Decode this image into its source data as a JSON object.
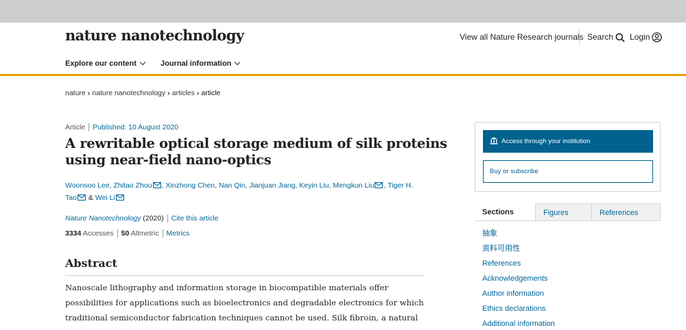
{
  "header": {
    "logo": "nature nanotechnology",
    "view_all": "View all Nature Research journals",
    "search": "Search",
    "login": "Login"
  },
  "nav": {
    "explore": "Explore our content",
    "journal_info": "Journal information"
  },
  "breadcrumb": [
    "nature",
    "nature nanotechnology",
    "articles",
    "article"
  ],
  "article": {
    "type": "Article",
    "published": "Published: 10 August 2020",
    "title": "A rewritable optical storage medium of silk proteins using near-field nano-optics",
    "authors": {
      "a1": "Woonsoo Lee,",
      "a2": "Zhitao Zhou",
      "a3": ", Xinzhong Chen, Nan Qin, Jianjuan Jiang, Keyin Liu, Mengkun Liu",
      "a4": ", Tiger H. Tao",
      "amp": "&",
      "a5": "Wei Li"
    },
    "journal_name": "Nature Nanotechnology",
    "year": "(2020)",
    "cite": "Cite this article",
    "accesses_count": "3334",
    "accesses_label": "Accesses",
    "altmetric_count": "50",
    "altmetric_label": "Altmetric",
    "metrics_link": "Metrics"
  },
  "abstract": {
    "heading": "Abstract",
    "line1": "Nanoscale lithography and information storage in biocompatible materials offer",
    "line2": "possibilities for applications such as bioelectronics and degradable electronics for which",
    "line3": "traditional semiconductor fabrication techniques cannot be used. Silk fibroin, a natural"
  },
  "sidebar": {
    "access_institution": "Access through your institution",
    "buy_subscribe": "Buy or subscribe",
    "tabs": [
      "Sections",
      "Figures",
      "References"
    ],
    "sections": [
      "抽象",
      "资料可用性",
      "References",
      "Acknowledgements",
      "Author information",
      "Ethics declarations",
      "Additional information"
    ]
  },
  "colors": {
    "brand_accent": "#e8a000",
    "link": "#006699",
    "button": "#01628f"
  }
}
